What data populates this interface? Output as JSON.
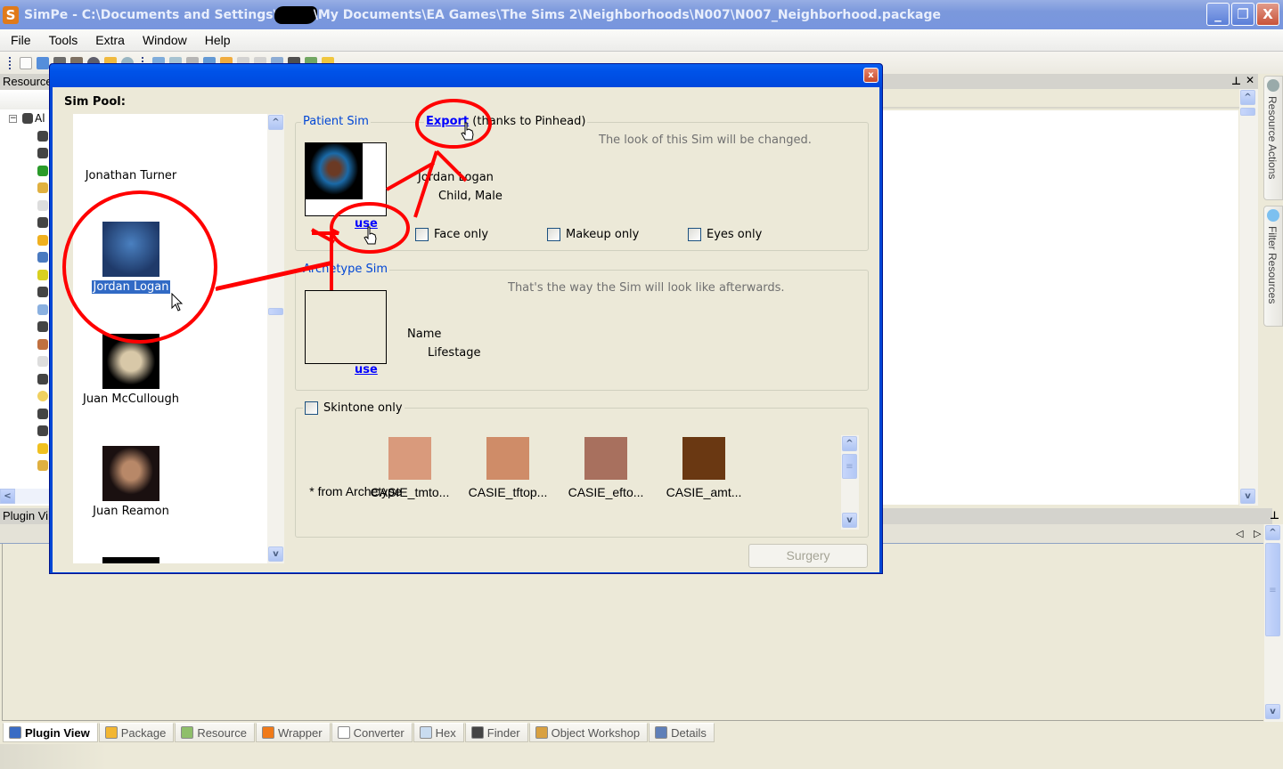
{
  "window": {
    "app_name": "SimPe",
    "title_prefix": "SimPe - C:\\Documents and Settings\\",
    "title_suffix": "\\My Documents\\EA Games\\The Sims 2\\Neighborhoods\\N007\\N007_Neighborhood.package",
    "minimize_icon": "_",
    "maximize_icon": "❐",
    "close_icon": "X"
  },
  "menubar": {
    "items": [
      "File",
      "Tools",
      "Extra",
      "Window",
      "Help"
    ]
  },
  "left_panel": {
    "header": "Resource",
    "tree_root_label": "Al",
    "tree_root_expander": "−",
    "scroll_left_icon": "<"
  },
  "plugin_panel": {
    "header": "Plugin Vi",
    "pin_icon": "⊥",
    "nav_icons": "◁ ▷"
  },
  "right_panel": {
    "pin_icon": "⊥",
    "close_icon": "✕",
    "side_tabs": [
      "Resource Actions",
      "Filter Resources"
    ]
  },
  "dialog": {
    "close_icon": "x",
    "sim_pool_label": "Sim Pool:",
    "sim_pool": [
      {
        "name": "Jonathan Turner",
        "selected": false,
        "has_thumb": false
      },
      {
        "name": "Jordan Logan",
        "selected": true,
        "has_thumb": true
      },
      {
        "name": "Juan McCullough",
        "selected": false,
        "has_thumb": true
      },
      {
        "name": "Juan Reamon",
        "selected": false,
        "has_thumb": true
      }
    ],
    "patient": {
      "legend": "Patient Sim",
      "export_link": "Export",
      "export_note": "(thanks to Pinhead)",
      "hint": "The look of this Sim will be changed.",
      "name": "Jordan Logan",
      "info": "Child, Male",
      "use_link": "use",
      "checkboxes": [
        {
          "label": "Face only",
          "checked": false
        },
        {
          "label": "Makeup only",
          "checked": false
        },
        {
          "label": "Eyes only",
          "checked": false
        }
      ]
    },
    "archetype": {
      "legend": "Archetype Sim",
      "hint": "That's the way the Sim will look like afterwards.",
      "name": "Name",
      "info": "Lifestage",
      "use_link": "use"
    },
    "skintone": {
      "checkbox_label": "Skintone only",
      "checked": false,
      "from_archetype": "* from Archetype",
      "items": [
        {
          "label": "CASIE_tmto...",
          "color": "#d99a7c"
        },
        {
          "label": "CASIE_tftop...",
          "color": "#cf8c68"
        },
        {
          "label": "CASIE_efto...",
          "color": "#a8705e"
        },
        {
          "label": "CASIE_amt...",
          "color": "#6a3812"
        }
      ]
    },
    "surgery_button": "Surgery"
  },
  "bottom_tabs": [
    {
      "label": "Plugin View",
      "active": true,
      "icon": "plugin-view-icon",
      "color": "#3a6cc4"
    },
    {
      "label": "Package",
      "active": false,
      "icon": "package-icon",
      "color": "#f2b632"
    },
    {
      "label": "Resource",
      "active": false,
      "icon": "resource-icon",
      "color": "#8fbf6a"
    },
    {
      "label": "Wrapper",
      "active": false,
      "icon": "wrapper-icon",
      "color": "#f07a18"
    },
    {
      "label": "Converter",
      "active": false,
      "icon": "converter-icon",
      "color": "#ffffff"
    },
    {
      "label": "Hex",
      "active": false,
      "icon": "hex-icon",
      "color": "#c9dcf0"
    },
    {
      "label": "Finder",
      "active": false,
      "icon": "binoculars-icon",
      "color": "#444444"
    },
    {
      "label": "Object Workshop",
      "active": false,
      "icon": "object-workshop-icon",
      "color": "#d8a040"
    },
    {
      "label": "Details",
      "active": false,
      "icon": "details-icon",
      "color": "#5f7fb8"
    }
  ],
  "colors": {
    "xp_blue": "#0046d5",
    "selection": "#316ac5",
    "annotation_red": "#ff0000"
  }
}
